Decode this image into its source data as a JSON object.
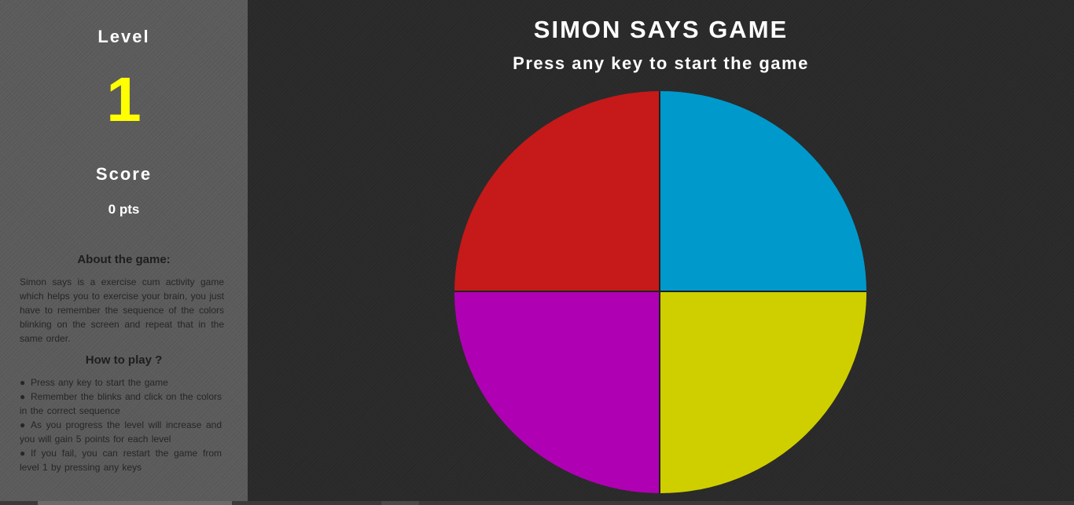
{
  "sidebar": {
    "level_label": "Level",
    "level_value": "1",
    "score_label": "Score",
    "score_value": "0 pts",
    "about_title": "About the game:",
    "about_text": "Simon says is a exercise cum activity game which helps you to exercise your brain, you just have to remember the sequence of the colors blinking on the screen and repeat that in the same order.",
    "howto_title": "How to play ?",
    "howto_items": [
      "Press any key to start the game",
      "Remember the blinks and click on the colors in the correct sequence",
      "As you progress the level will increase and you will gain 5 points for each level",
      "If you fail, you can restart the game from level 1 by pressing any keys"
    ],
    "bullet": "●"
  },
  "main": {
    "title": "SIMON SAYS GAME",
    "subtitle": "Press any key to start the game"
  },
  "board": {
    "colors": {
      "red": "#c61919",
      "blue": "#0099cc",
      "purple": "#b000b4",
      "yellow": "#cfcf00"
    }
  },
  "theme": {
    "level_color": "#ffff00",
    "sidebar_bg": "#5b5b5b",
    "main_bg": "#2a2a2a"
  }
}
